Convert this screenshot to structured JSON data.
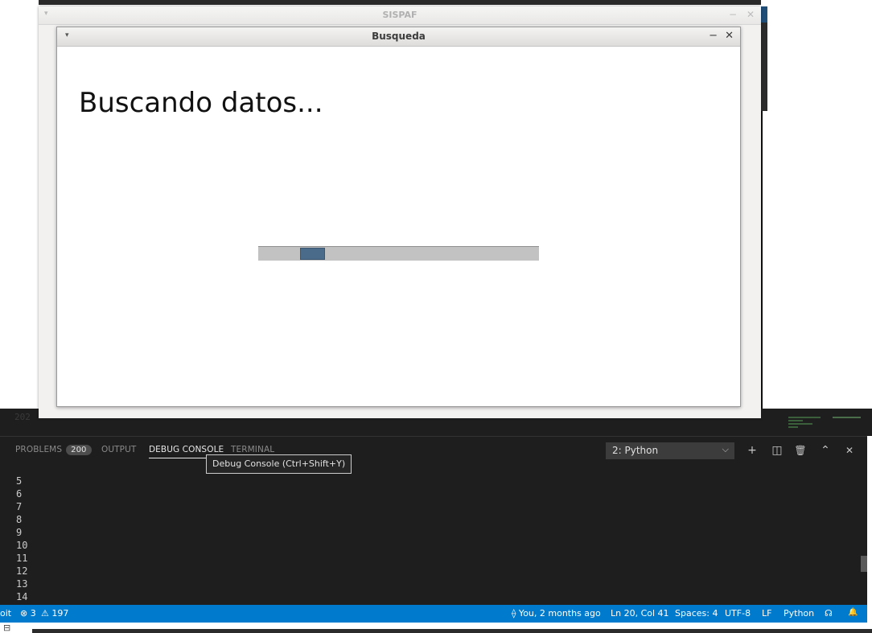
{
  "sispaf": {
    "title": "SISPAF",
    "minimize": "−",
    "close": "✕",
    "menu_arrow": "▾"
  },
  "busqueda": {
    "title": "Busqueda",
    "menu_arrow": "▾",
    "minimize": "−",
    "close": "✕",
    "message": "Buscando datos...",
    "progress": {
      "mode": "indeterminate",
      "chunk_start_fraction": 0.15,
      "chunk_width_fraction": 0.09
    }
  },
  "editor": {
    "ghost_line_number": "202"
  },
  "panel": {
    "tabs": [
      {
        "label": "PROBLEMS",
        "badge": "200"
      },
      {
        "label": "OUTPUT"
      },
      {
        "label": "DEBUG CONSOLE",
        "active": true
      },
      {
        "label": "TERMINAL"
      }
    ],
    "tooltip": "Debug Console (Ctrl+Shift+Y)",
    "terminal_select": "2: Python",
    "icons": [
      "plus-icon",
      "split-icon",
      "trash-icon",
      "chevron-up-icon",
      "close-icon"
    ],
    "glyphs": {
      "add": "+",
      "split": "◫",
      "trash": "🗑",
      "maximize": "⌃",
      "close": "✕",
      "dropdown": "⌵"
    },
    "lines": [
      "5",
      "6",
      "7",
      "8",
      "9",
      "10",
      "11",
      "12",
      "13",
      "14"
    ]
  },
  "statusbar": {
    "git": "oit",
    "errors": "⊗ 3",
    "warnings": "⚠ 197",
    "blame": "⟠ You, 2 months ago",
    "cursor": "Ln 20, Col 41",
    "spaces": "Spaces: 4",
    "encoding": "UTF-8",
    "eol": "LF",
    "language": "Python",
    "feedback": "☊",
    "bell": "🔔"
  },
  "colors": {
    "statusbar": "#007acc",
    "panel_bg": "#1e1e1e",
    "progress_track": "#c2c2c2",
    "progress_chunk": "#4a6b8a"
  }
}
